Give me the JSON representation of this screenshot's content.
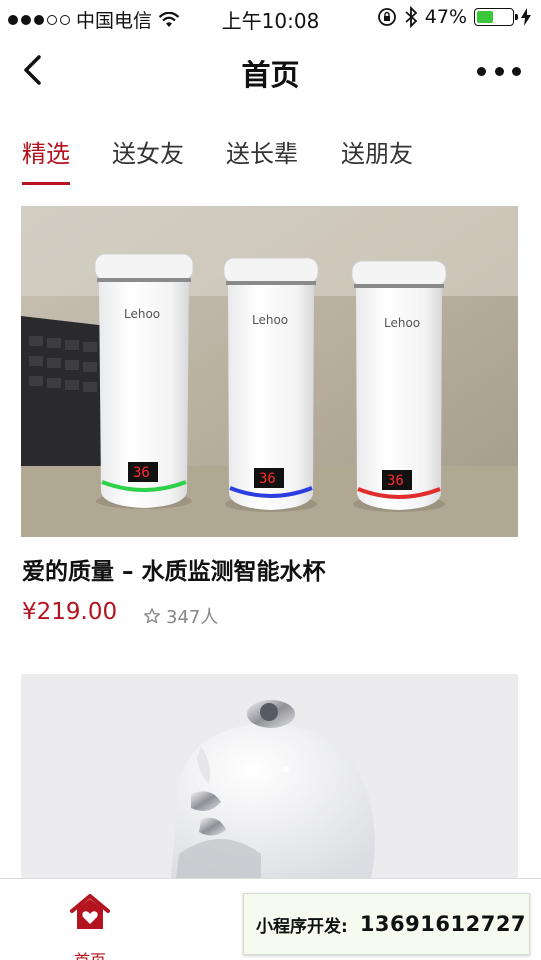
{
  "status_bar": {
    "carrier": "中国电信",
    "time": "上午10:08",
    "battery_percent": "47%",
    "battery_level": 0.47
  },
  "nav": {
    "title": "首页"
  },
  "tabs": [
    {
      "label": "精选",
      "active": true
    },
    {
      "label": "送女友",
      "active": false
    },
    {
      "label": "送长辈",
      "active": false
    },
    {
      "label": "送朋友",
      "active": false
    }
  ],
  "products": [
    {
      "title": "爱的质量 – 水质监测智能水杯",
      "price": "¥219.00",
      "likes": "347人",
      "brand_on_image": "Lehoo",
      "display_value": "36",
      "ring_colors": [
        "#2fd14a",
        "#2c3ee0",
        "#e02c2c"
      ]
    }
  ],
  "tab_bar": {
    "home_label": "首页"
  },
  "contact_banner": {
    "label": "小程序开发:",
    "phone": "13691612727"
  },
  "colors": {
    "accent": "#b3141f",
    "battery": "#3cc63c"
  }
}
